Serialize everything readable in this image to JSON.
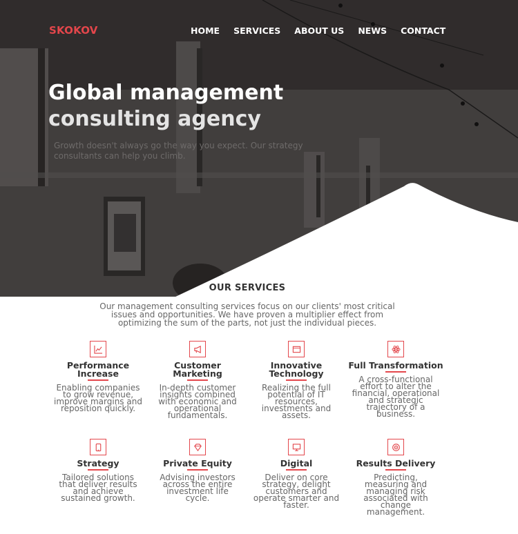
{
  "brand": {
    "logo": "SKOKOV",
    "accent": "#e3464b"
  },
  "nav": {
    "items": [
      "HOME",
      "SERVICES",
      "ABOUT US",
      "NEWS",
      "CONTACT"
    ]
  },
  "hero": {
    "title_line1": "Global management",
    "title_line2": "consulting agency",
    "subtitle": "Growth doesn't always go the way you expect. Our strategy consultants can help you climb."
  },
  "services": {
    "heading": "OUR SERVICES",
    "intro": "Our management consulting services focus on our clients' most critical issues and opportunities. We have proven a multiplier effect from optimizing the sum of the parts, not just the individual pieces.",
    "items": [
      {
        "icon": "chart-icon",
        "title": "Performance Increase",
        "desc": "Enabling companies to grow revenue, improve margins and reposition quickly."
      },
      {
        "icon": "megaphone-icon",
        "title": "Customer Marketing",
        "desc": "In-depth customer insights combined with economic and operational fundamentals."
      },
      {
        "icon": "browser-icon",
        "title": "Innovative Technology",
        "desc": "Realizing the full potential of IT resources, investments and assets."
      },
      {
        "icon": "atom-icon",
        "title": "Full Transformation",
        "desc": "A cross-functional effort to alter the financial, operational and strategic trajectory of a business."
      },
      {
        "icon": "phone-icon",
        "title": "Strategy",
        "desc": "Tailored solutions that deliver results and achieve sustained growth."
      },
      {
        "icon": "diamond-icon",
        "title": "Private Equity",
        "desc": "Advising investors across the entire investment life cycle."
      },
      {
        "icon": "monitor-icon",
        "title": "Digital",
        "desc": "Deliver on core strategy, delight customers and operate smarter and faster."
      },
      {
        "icon": "target-icon",
        "title": "Results Delivery",
        "desc": "Predicting, measuring and managing risk associated with change management."
      }
    ]
  }
}
